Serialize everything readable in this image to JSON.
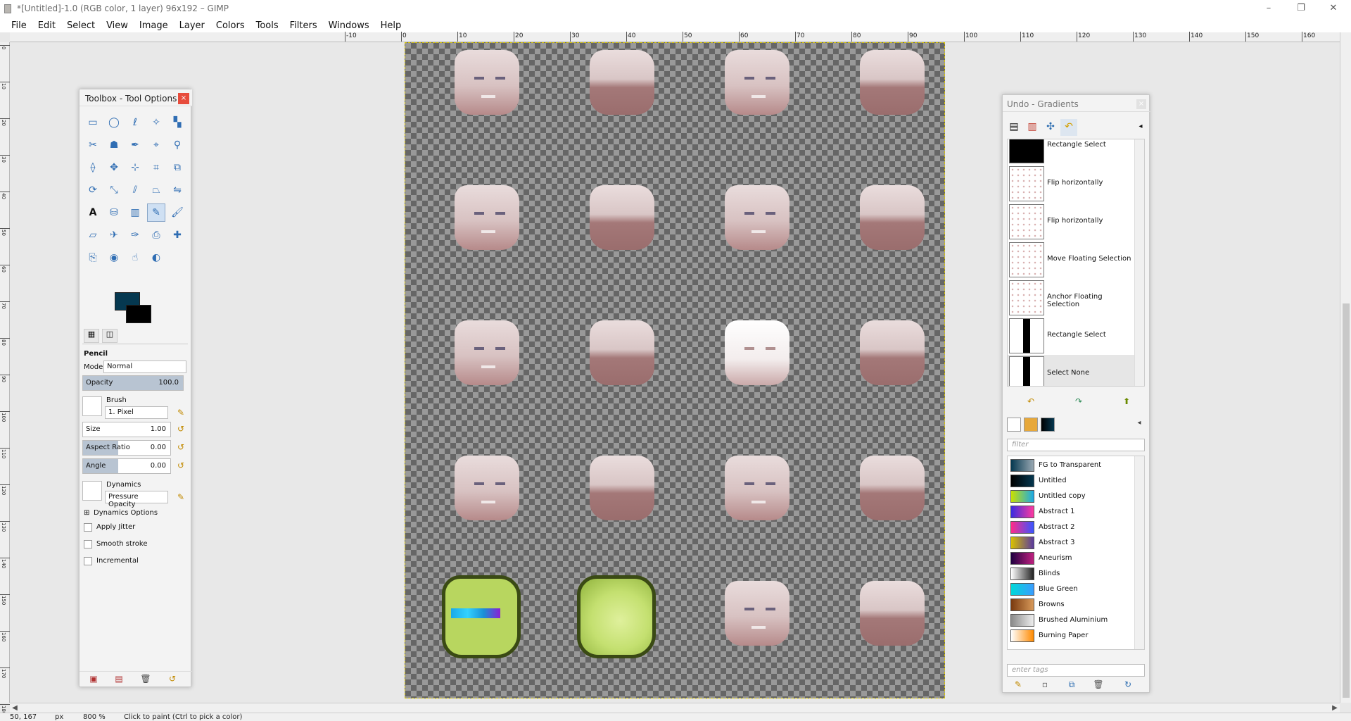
{
  "window": {
    "title": "*[Untitled]-1.0 (RGB color, 1 layer) 96x192 – GIMP",
    "controls": [
      "–",
      "❐",
      "✕"
    ]
  },
  "menubar": [
    "File",
    "Edit",
    "Select",
    "View",
    "Image",
    "Layer",
    "Colors",
    "Tools",
    "Filters",
    "Windows",
    "Help"
  ],
  "ruler_top": [
    "-10",
    "0",
    "10",
    "20",
    "30",
    "40",
    "50",
    "60",
    "70",
    "80",
    "90",
    "100",
    "110",
    "120",
    "130",
    "140",
    "150",
    "160"
  ],
  "ruler_left": [
    "0",
    "10",
    "20",
    "30",
    "40",
    "50",
    "60",
    "70",
    "80",
    "90",
    "100",
    "110",
    "120",
    "130",
    "140",
    "150",
    "160",
    "170",
    "180"
  ],
  "toolbox": {
    "title": "Toolbox - Tool Options",
    "close": "×",
    "tools": [
      "rect-select",
      "ellipse-select",
      "free-select",
      "fuzzy-select",
      "select-by-color",
      "scissors",
      "foreground-select",
      "paths",
      "color-picker",
      "zoom",
      "measure",
      "move",
      "align",
      "crop",
      "transform-unified",
      "rotate",
      "scale",
      "shear",
      "perspective",
      "flip",
      "text",
      "bucket-fill",
      "blend",
      "pencil",
      "paintbrush",
      "eraser",
      "airbrush",
      "ink",
      "clone",
      "heal",
      "perspective-clone",
      "blur",
      "smudge",
      "dodge-burn"
    ],
    "active_tool": "pencil",
    "fg_color": "#053850",
    "bg_color": "#000000",
    "options": {
      "tool_name": "Pencil",
      "mode_label": "Mode:",
      "mode_value": "Normal",
      "opacity_label": "Opacity",
      "opacity_value": "100.0",
      "brush_label": "Brush",
      "brush_value": "1. Pixel",
      "size_label": "Size",
      "size_value": "1.00",
      "aspect_label": "Aspect Ratio",
      "aspect_value": "0.00",
      "angle_label": "Angle",
      "angle_value": "0.00",
      "dynamics_label": "Dynamics",
      "dynamics_value": "Pressure Opacity",
      "dynamics_options": "Dynamics Options",
      "apply_jitter": "Apply Jitter",
      "smooth_stroke": "Smooth stroke",
      "incremental": "Incremental"
    }
  },
  "right_dock": {
    "title": "Undo - Gradients",
    "close": "×",
    "undo_items": [
      "Rectangle Select",
      "Flip horizontally",
      "Flip horizontally",
      "Move Floating Selection",
      "Anchor Floating Selection",
      "Rectangle Select",
      "Select None"
    ],
    "filter_placeholder": "filter",
    "tags_placeholder": "enter tags",
    "gradients": [
      {
        "name": "FG to Transparent",
        "colors": [
          "#053850",
          "#9aa9b3"
        ]
      },
      {
        "name": "Untitled",
        "colors": [
          "#000000",
          "#053850"
        ]
      },
      {
        "name": "Untitled copy",
        "colors": [
          "#c8e000",
          "#1aa9e8"
        ]
      },
      {
        "name": "Abstract 1",
        "colors": [
          "#3a2be0",
          "#ff3aa0"
        ]
      },
      {
        "name": "Abstract 2",
        "colors": [
          "#ff2a8a",
          "#3a55ff"
        ]
      },
      {
        "name": "Abstract 3",
        "colors": [
          "#d8c000",
          "#5a3aa0"
        ]
      },
      {
        "name": "Aneurism",
        "colors": [
          "#200040",
          "#c02080"
        ]
      },
      {
        "name": "Blinds",
        "colors": [
          "#ffffff",
          "#222222"
        ]
      },
      {
        "name": "Blue Green",
        "colors": [
          "#00d8d8",
          "#3a9cff"
        ]
      },
      {
        "name": "Browns",
        "colors": [
          "#7a3a10",
          "#d89a5a"
        ]
      },
      {
        "name": "Brushed Aluminium",
        "colors": [
          "#8a8a8a",
          "#eeeeee"
        ]
      },
      {
        "name": "Burning Paper",
        "colors": [
          "#ffffff",
          "#ff8a00"
        ]
      }
    ]
  },
  "statusbar": {
    "coords": "50, 167",
    "unit": "px",
    "zoom": "800 %",
    "message": "Click to paint (Ctrl to pick a color)"
  }
}
